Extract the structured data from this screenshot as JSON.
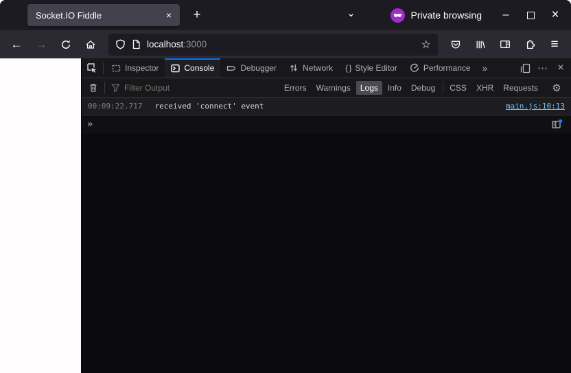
{
  "titlebar": {
    "tab_title": "Socket.IO Fiddle",
    "private_label": "Private browsing"
  },
  "navbar": {
    "url": {
      "host": "localhost",
      "port": ":3000"
    }
  },
  "devtools": {
    "tabs": [
      {
        "label": "Inspector",
        "active": false
      },
      {
        "label": "Console",
        "active": true
      },
      {
        "label": "Debugger",
        "active": false
      },
      {
        "label": "Network",
        "active": false
      },
      {
        "label": "Style Editor",
        "active": false
      },
      {
        "label": "Performance",
        "active": false
      }
    ],
    "filter": {
      "placeholder": "Filter Output",
      "levels": [
        {
          "label": "Errors",
          "active": false
        },
        {
          "label": "Warnings",
          "active": false
        },
        {
          "label": "Logs",
          "active": true
        },
        {
          "label": "Info",
          "active": false
        },
        {
          "label": "Debug",
          "active": false
        }
      ],
      "categories": [
        {
          "label": "CSS"
        },
        {
          "label": "XHR"
        },
        {
          "label": "Requests"
        }
      ]
    },
    "console": {
      "entries": [
        {
          "timestamp": "00:09:22.717",
          "message": "received 'connect' event",
          "source": "main.js:10:13"
        }
      ]
    }
  },
  "icons": {
    "new_tab": "+",
    "tab_close": "×",
    "chevron_down": "⌄",
    "minimize": "–",
    "window_close": "×",
    "back": "←",
    "forward": "→",
    "star": "☆",
    "hamburger": "≡",
    "more_tabs": "»",
    "meatball": "⋯",
    "devtools_close": "×",
    "style_editor_braces": "{ }",
    "prompt": "»",
    "gear": "⚙"
  },
  "colors": {
    "accent_blue": "#0074e8",
    "link_blue": "#75bfff",
    "private_purple": "#a02bce",
    "devtools_bg": "#0b0b0d",
    "toolbar_bg": "#18181a",
    "titlebar_bg": "#1c1b22",
    "navbar_bg": "#2b2a33",
    "active_tab_bg": "#42414d"
  }
}
